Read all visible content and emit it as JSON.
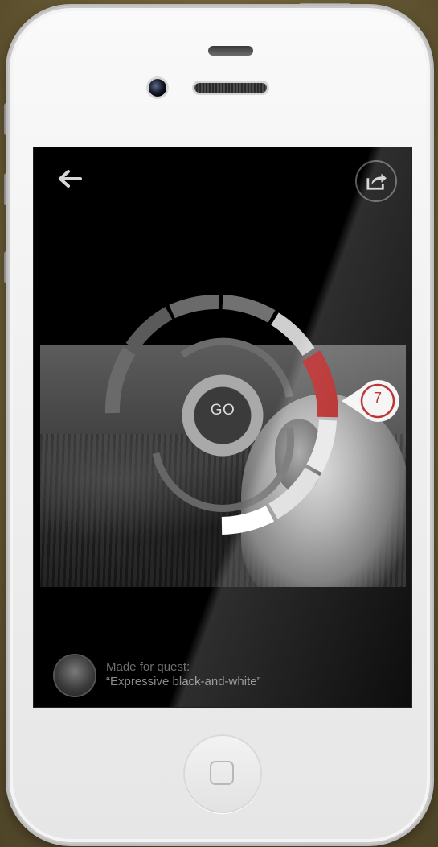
{
  "device": {
    "frame_color": "#f2f2f2",
    "background_color": "#6b5d36"
  },
  "header": {
    "back_icon": "back-arrow-icon",
    "share_icon": "share-icon"
  },
  "dial": {
    "center_label": "GO",
    "selected_value": "7",
    "accent_color": "#b01818",
    "segments": [
      "inactive",
      "inactive",
      "inactive",
      "inactive",
      "light",
      "selected",
      "light",
      "light",
      "white"
    ]
  },
  "footer": {
    "line1": "Made for quest:",
    "line2": "“Expressive black-and-white”"
  }
}
